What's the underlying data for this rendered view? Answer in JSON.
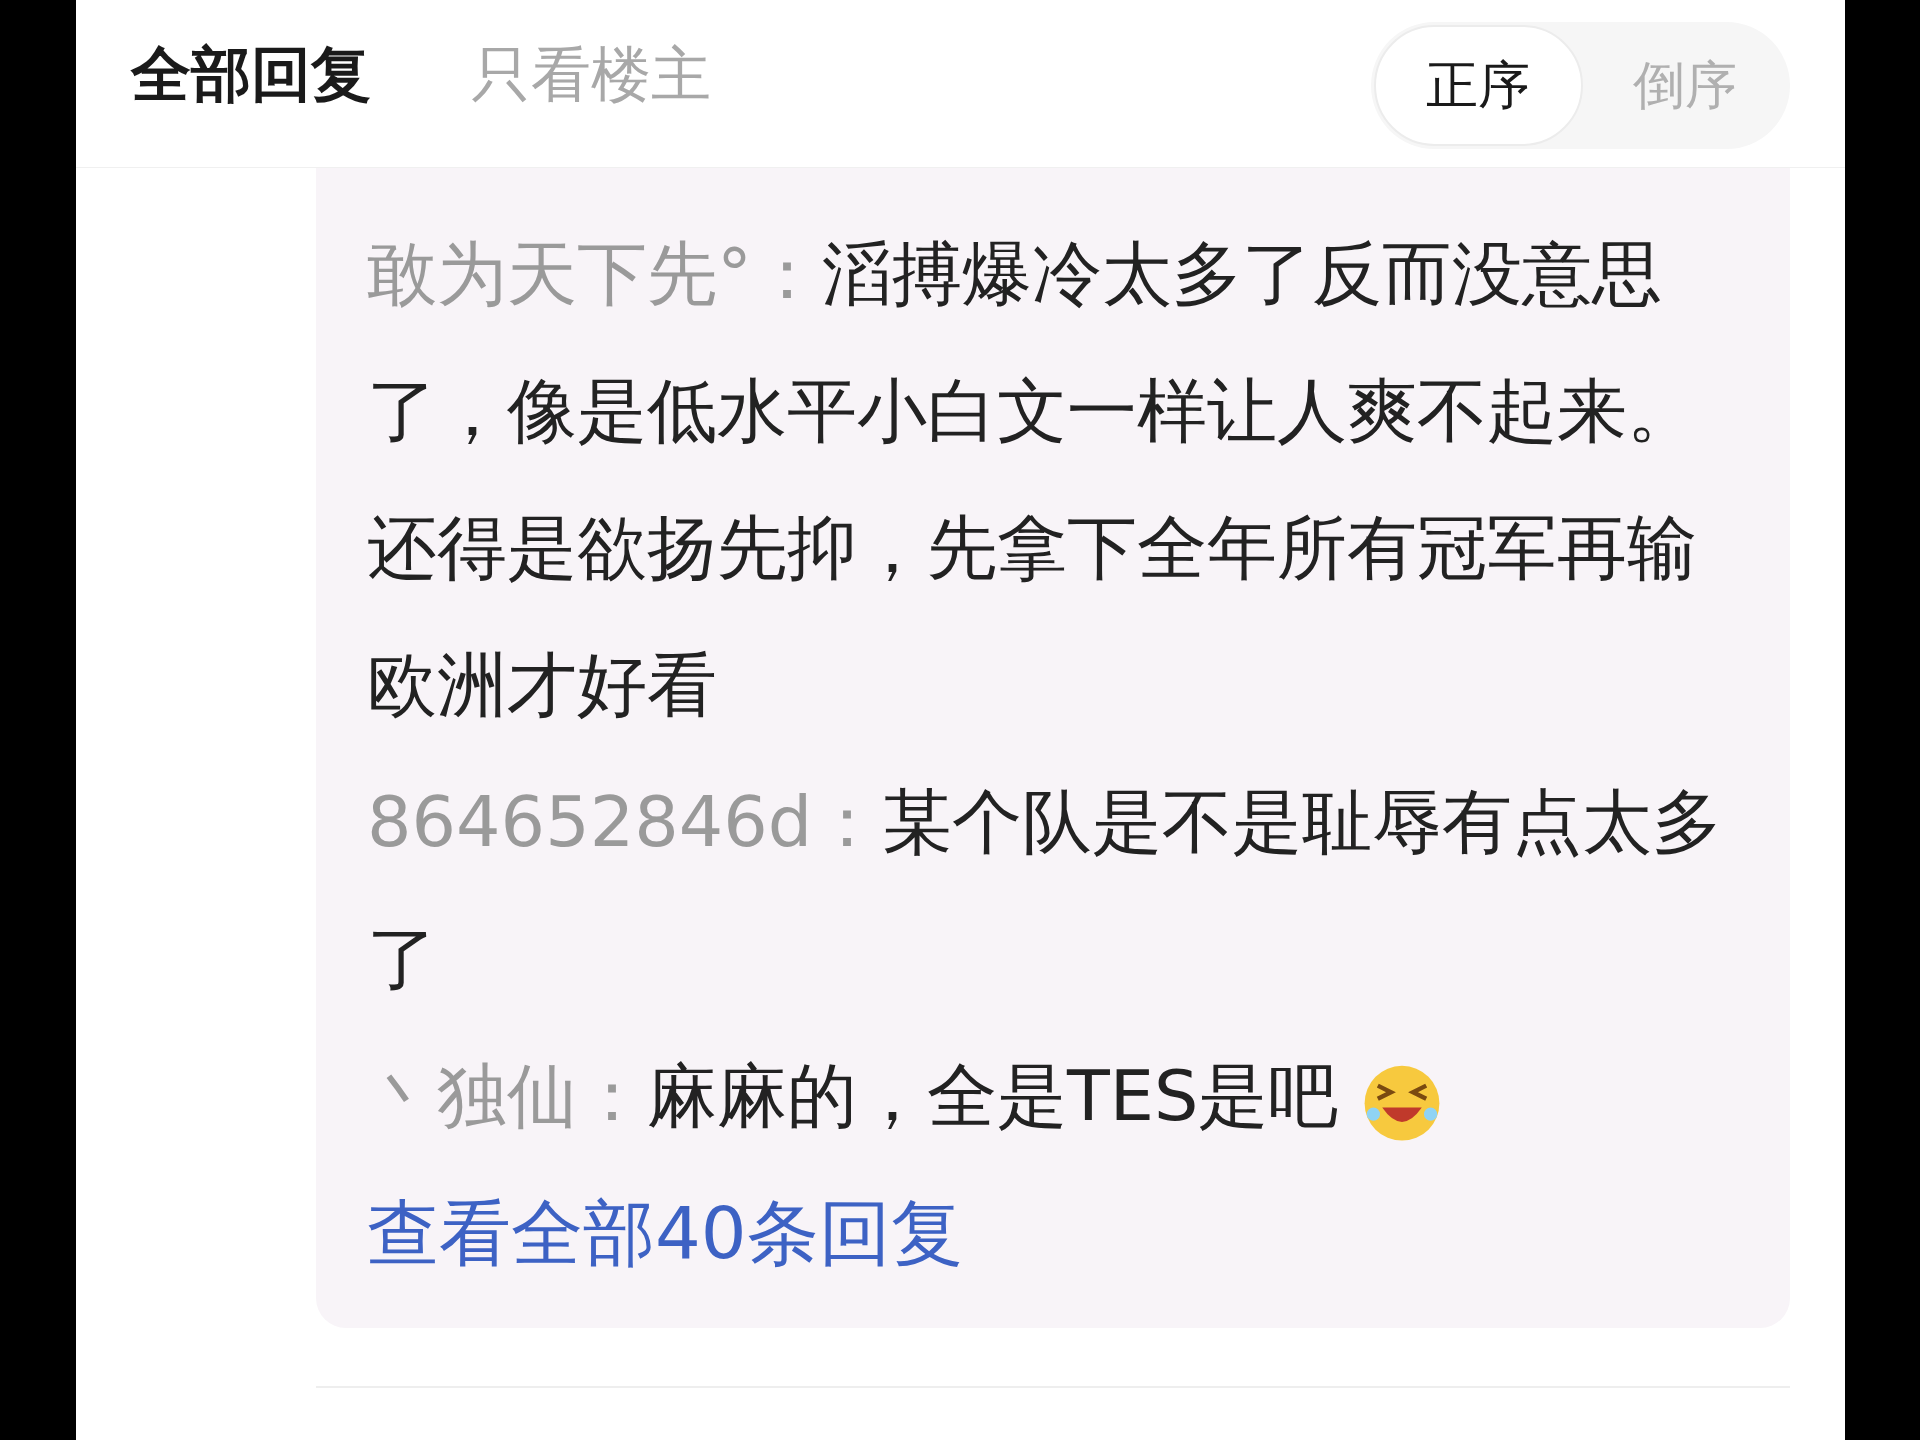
{
  "tabs": [
    {
      "label": "全部回复",
      "selected": true
    },
    {
      "label": "只看楼主",
      "selected": false
    }
  ],
  "sort_options": [
    {
      "label": "正序",
      "selected": true
    },
    {
      "label": "倒序",
      "selected": false
    }
  ],
  "replies": [
    {
      "author": "敢为天下先°：",
      "text": "滔搏爆冷太多了反而没意思了，像是低水平小白文一样让人爽不起来。还得是欲扬先抑，先拿下全年所有冠军再输欧洲才好看",
      "emoji": false
    },
    {
      "author": "864652846d：",
      "text": "某个队是不是耻辱有点太多了",
      "emoji": false
    },
    {
      "author": "丶独仙：",
      "text": "麻麻的，全是TES是吧",
      "emoji": true
    }
  ],
  "view_all_link": "查看全部40条回复"
}
